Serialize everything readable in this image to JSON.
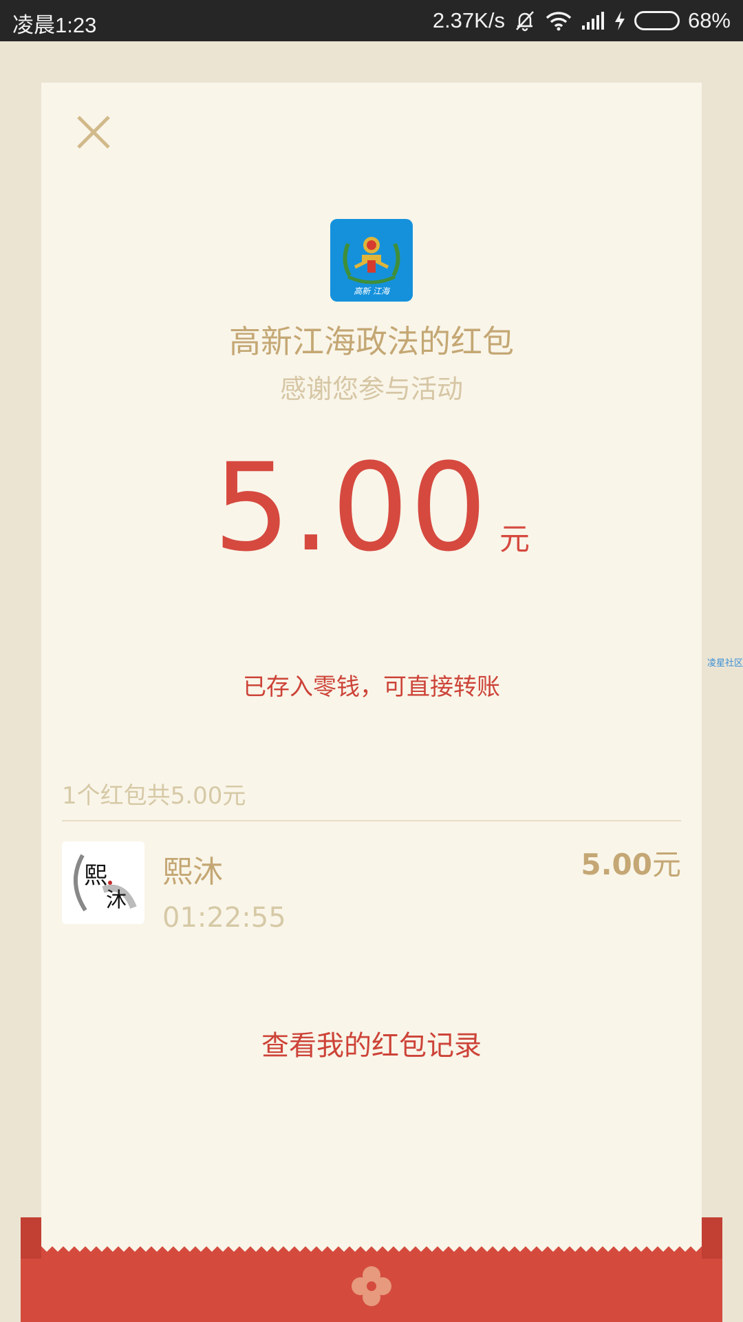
{
  "status_bar": {
    "time": "凌晨1:23",
    "network_speed": "2.37K/s",
    "battery_percent": "68%",
    "battery_level": 0.68,
    "icons": [
      "mute-bell-icon",
      "wifi-icon",
      "signal-icon",
      "charging-bolt-icon",
      "battery-icon"
    ]
  },
  "envelope": {
    "close_icon": "close-icon",
    "logo": {
      "icon": "emblem-logo-icon",
      "text": "高新 江海"
    },
    "sender_title": "高新江海政法的红包",
    "wish": "感谢您参与活动",
    "amount": "5.00",
    "amount_unit": "元",
    "amount_note": "已存入零钱，可直接转账",
    "summary": "1个红包共5.00元",
    "receivers": [
      {
        "avatar_text": [
          "熙",
          "沐"
        ],
        "name": "熙沐",
        "time": "01:22:55",
        "amount": "5.00",
        "unit": "元"
      }
    ],
    "record_link": "查看我的红包记录"
  },
  "side_label": "凌星社区",
  "colors": {
    "background": "#ebe4d3",
    "card": "#f9f5e9",
    "gold": "#c4a774",
    "gold_light": "#d6c9a6",
    "red": "#d6493f",
    "envelope_red": "#d44b3e",
    "logo_blue": "#1591dc"
  }
}
